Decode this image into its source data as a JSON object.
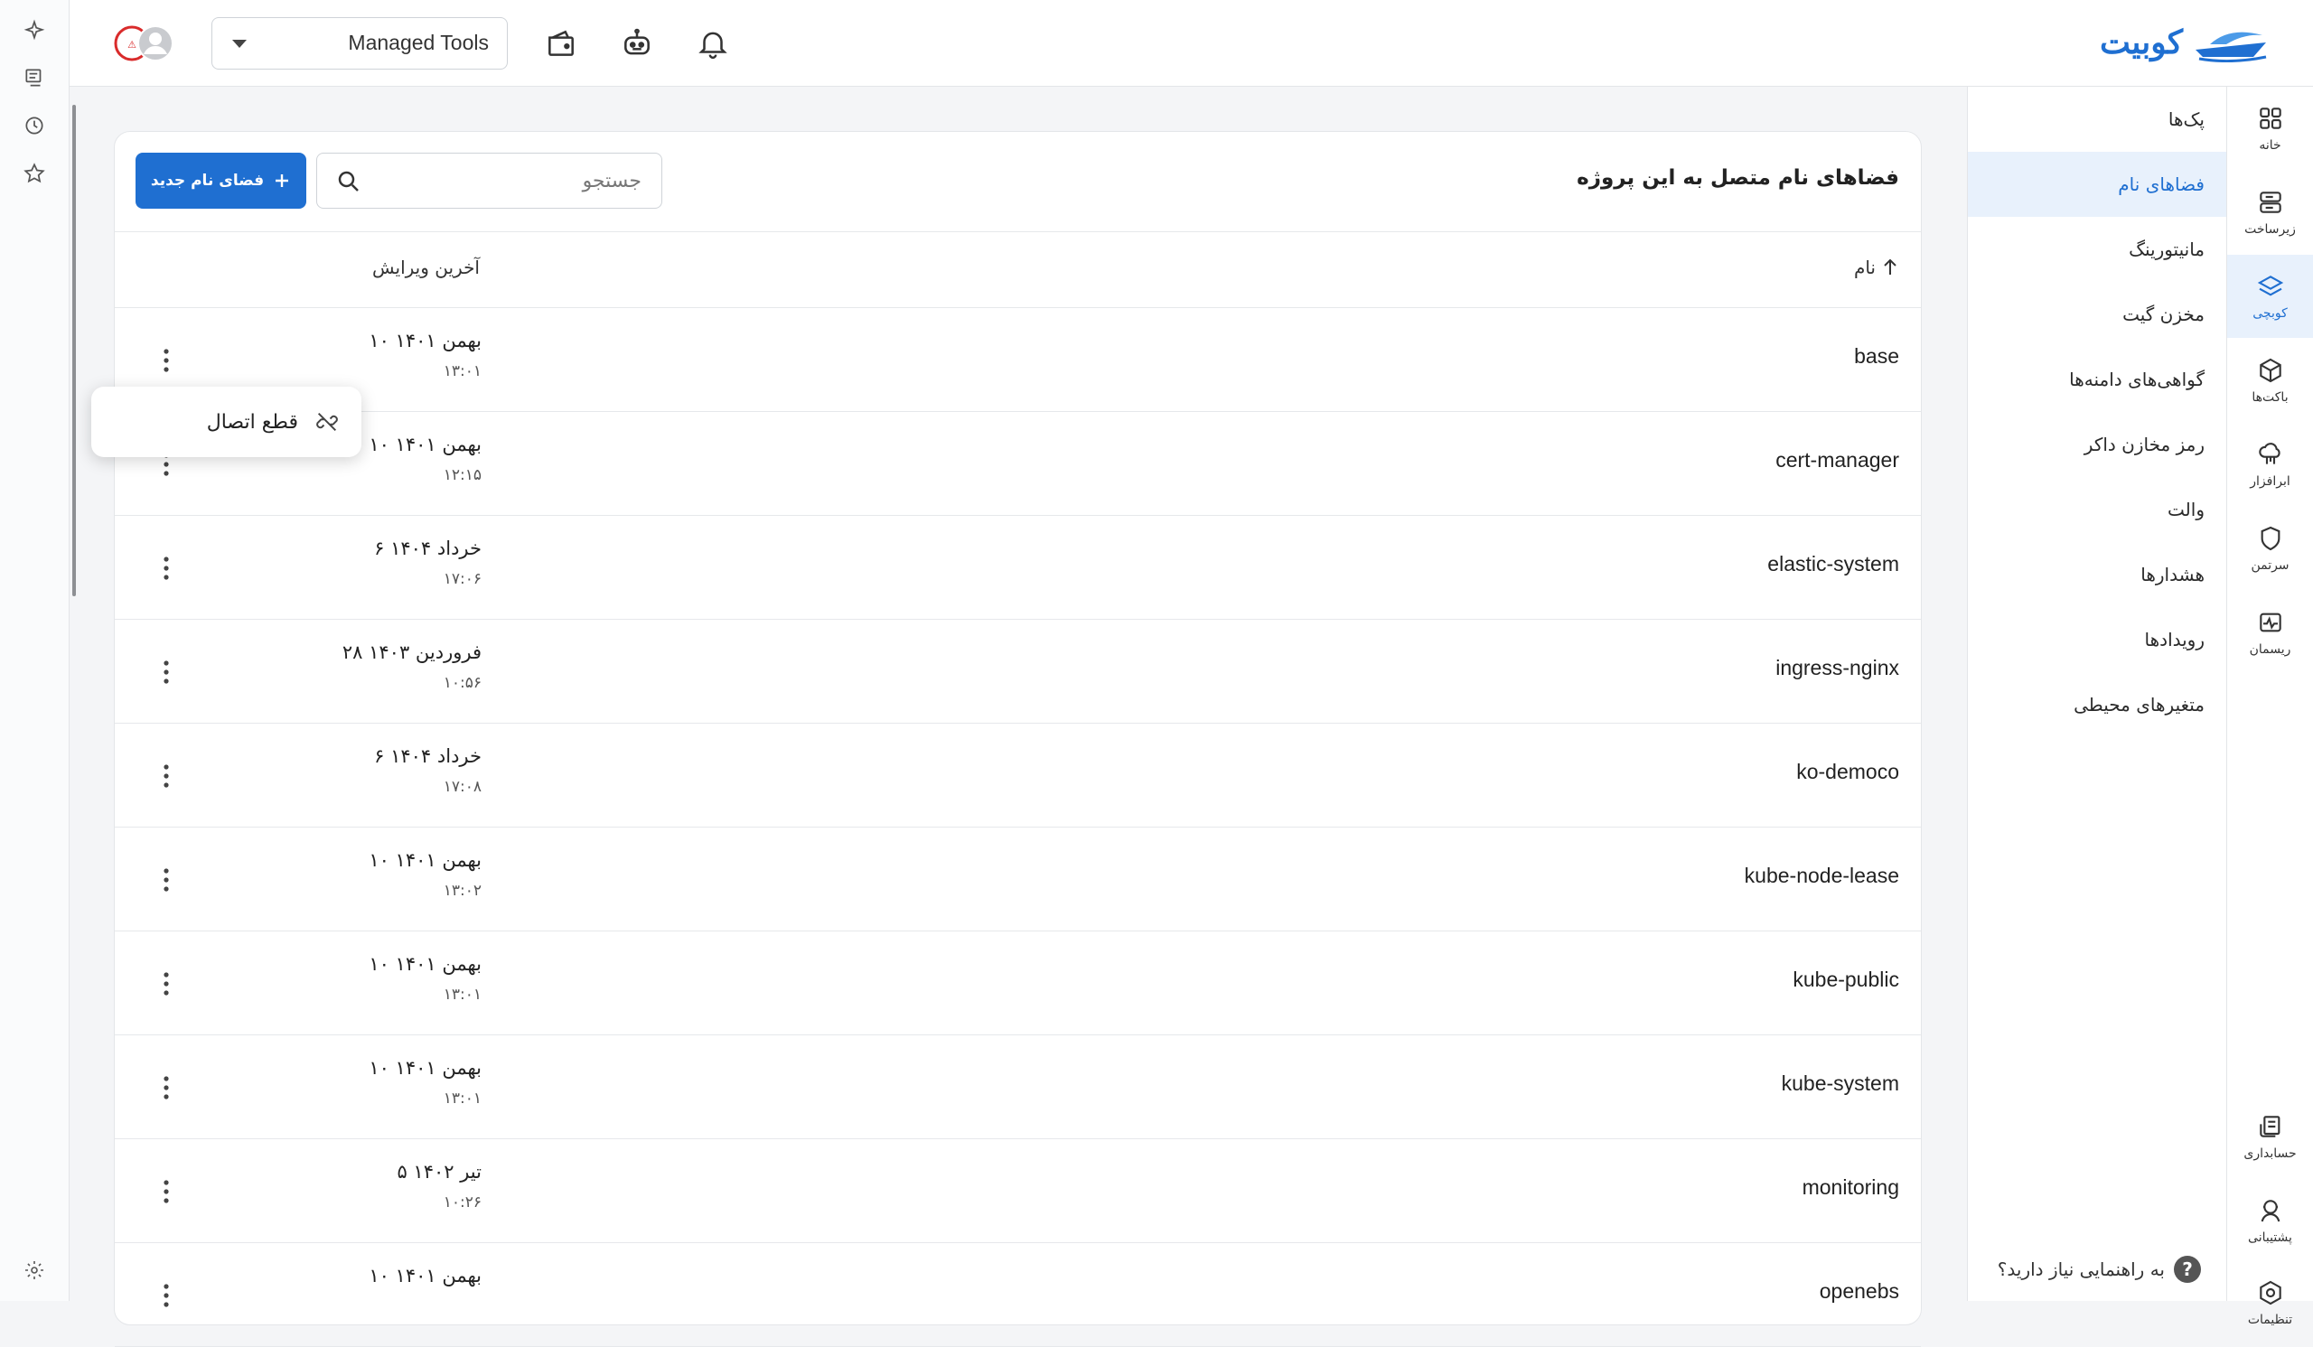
{
  "app": {
    "logo_text": "کوبیت",
    "brand_color": "#1f6fd1"
  },
  "topbar": {
    "project_selector_value": "Managed Tools",
    "icons": [
      "bell-icon",
      "robot-icon",
      "wallet-icon",
      "avatar-icon"
    ]
  },
  "rail": {
    "items": [
      {
        "label": "خانه",
        "icon": "grid-icon"
      },
      {
        "label": "زیرساخت",
        "icon": "server-icon"
      },
      {
        "label": "کوبچی",
        "icon": "layers-icon"
      },
      {
        "label": "باکت‌ها",
        "icon": "cube-icon"
      },
      {
        "label": "ابرافزار",
        "icon": "cloud-app-icon"
      },
      {
        "label": "سرتمن",
        "icon": "shield-icon"
      },
      {
        "label": "ریسمان",
        "icon": "pulse-icon"
      }
    ],
    "bottom_items": [
      {
        "label": "حسابداری",
        "icon": "accounting-icon"
      },
      {
        "label": "پشتیبانی",
        "icon": "support-icon"
      },
      {
        "label": "تنظیمات",
        "icon": "settings-hex-icon"
      }
    ]
  },
  "subnav": {
    "items": [
      {
        "label": "پک‌ها"
      },
      {
        "label": "فضاهای نام"
      },
      {
        "label": "مانیتورینگ"
      },
      {
        "label": "مخزن گیت"
      },
      {
        "label": "گواهی‌های دامنه‌ها"
      },
      {
        "label": "رمز مخازن داکر"
      },
      {
        "label": "والت"
      },
      {
        "label": "هشدارها"
      },
      {
        "label": "رویدادها"
      },
      {
        "label": "متغیرهای محیطی"
      }
    ],
    "help_text": "به راهنمایی نیاز دارید؟",
    "help_icon": "?"
  },
  "main": {
    "title": "فضاهای نام متصل به این پروژه",
    "search_placeholder": "جستجو",
    "new_button_label": "فضای نام جدید",
    "columns": {
      "name": "نام",
      "last_edit": "آخرین ویرایش"
    },
    "rows": [
      {
        "name": "base",
        "date": "۱۰ بهمن ۱۴۰۱",
        "time": "۱۳:۰۱"
      },
      {
        "name": "cert-manager",
        "date": "۱۰ بهمن ۱۴۰۱",
        "time": "۱۲:۱۵"
      },
      {
        "name": "elastic-system",
        "date": "۶ خرداد ۱۴۰۴",
        "time": "۱۷:۰۶"
      },
      {
        "name": "ingress-nginx",
        "date": "۲۸ فروردین ۱۴۰۳",
        "time": "۱۰:۵۶"
      },
      {
        "name": "ko-democo",
        "date": "۶ خرداد ۱۴۰۴",
        "time": "۱۷:۰۸"
      },
      {
        "name": "kube-node-lease",
        "date": "۱۰ بهمن ۱۴۰۱",
        "time": "۱۳:۰۲"
      },
      {
        "name": "kube-public",
        "date": "۱۰ بهمن ۱۴۰۱",
        "time": "۱۳:۰۱"
      },
      {
        "name": "kube-system",
        "date": "۱۰ بهمن ۱۴۰۱",
        "time": "۱۳:۰۱"
      },
      {
        "name": "monitoring",
        "date": "۵ تیر ۱۴۰۲",
        "time": "۱۰:۲۶"
      },
      {
        "name": "openebs",
        "date": "۱۰ بهمن ۱۴۰۱",
        "time": ""
      }
    ]
  },
  "popup": {
    "label": "قطع اتصال",
    "icon": "unlink-icon"
  }
}
